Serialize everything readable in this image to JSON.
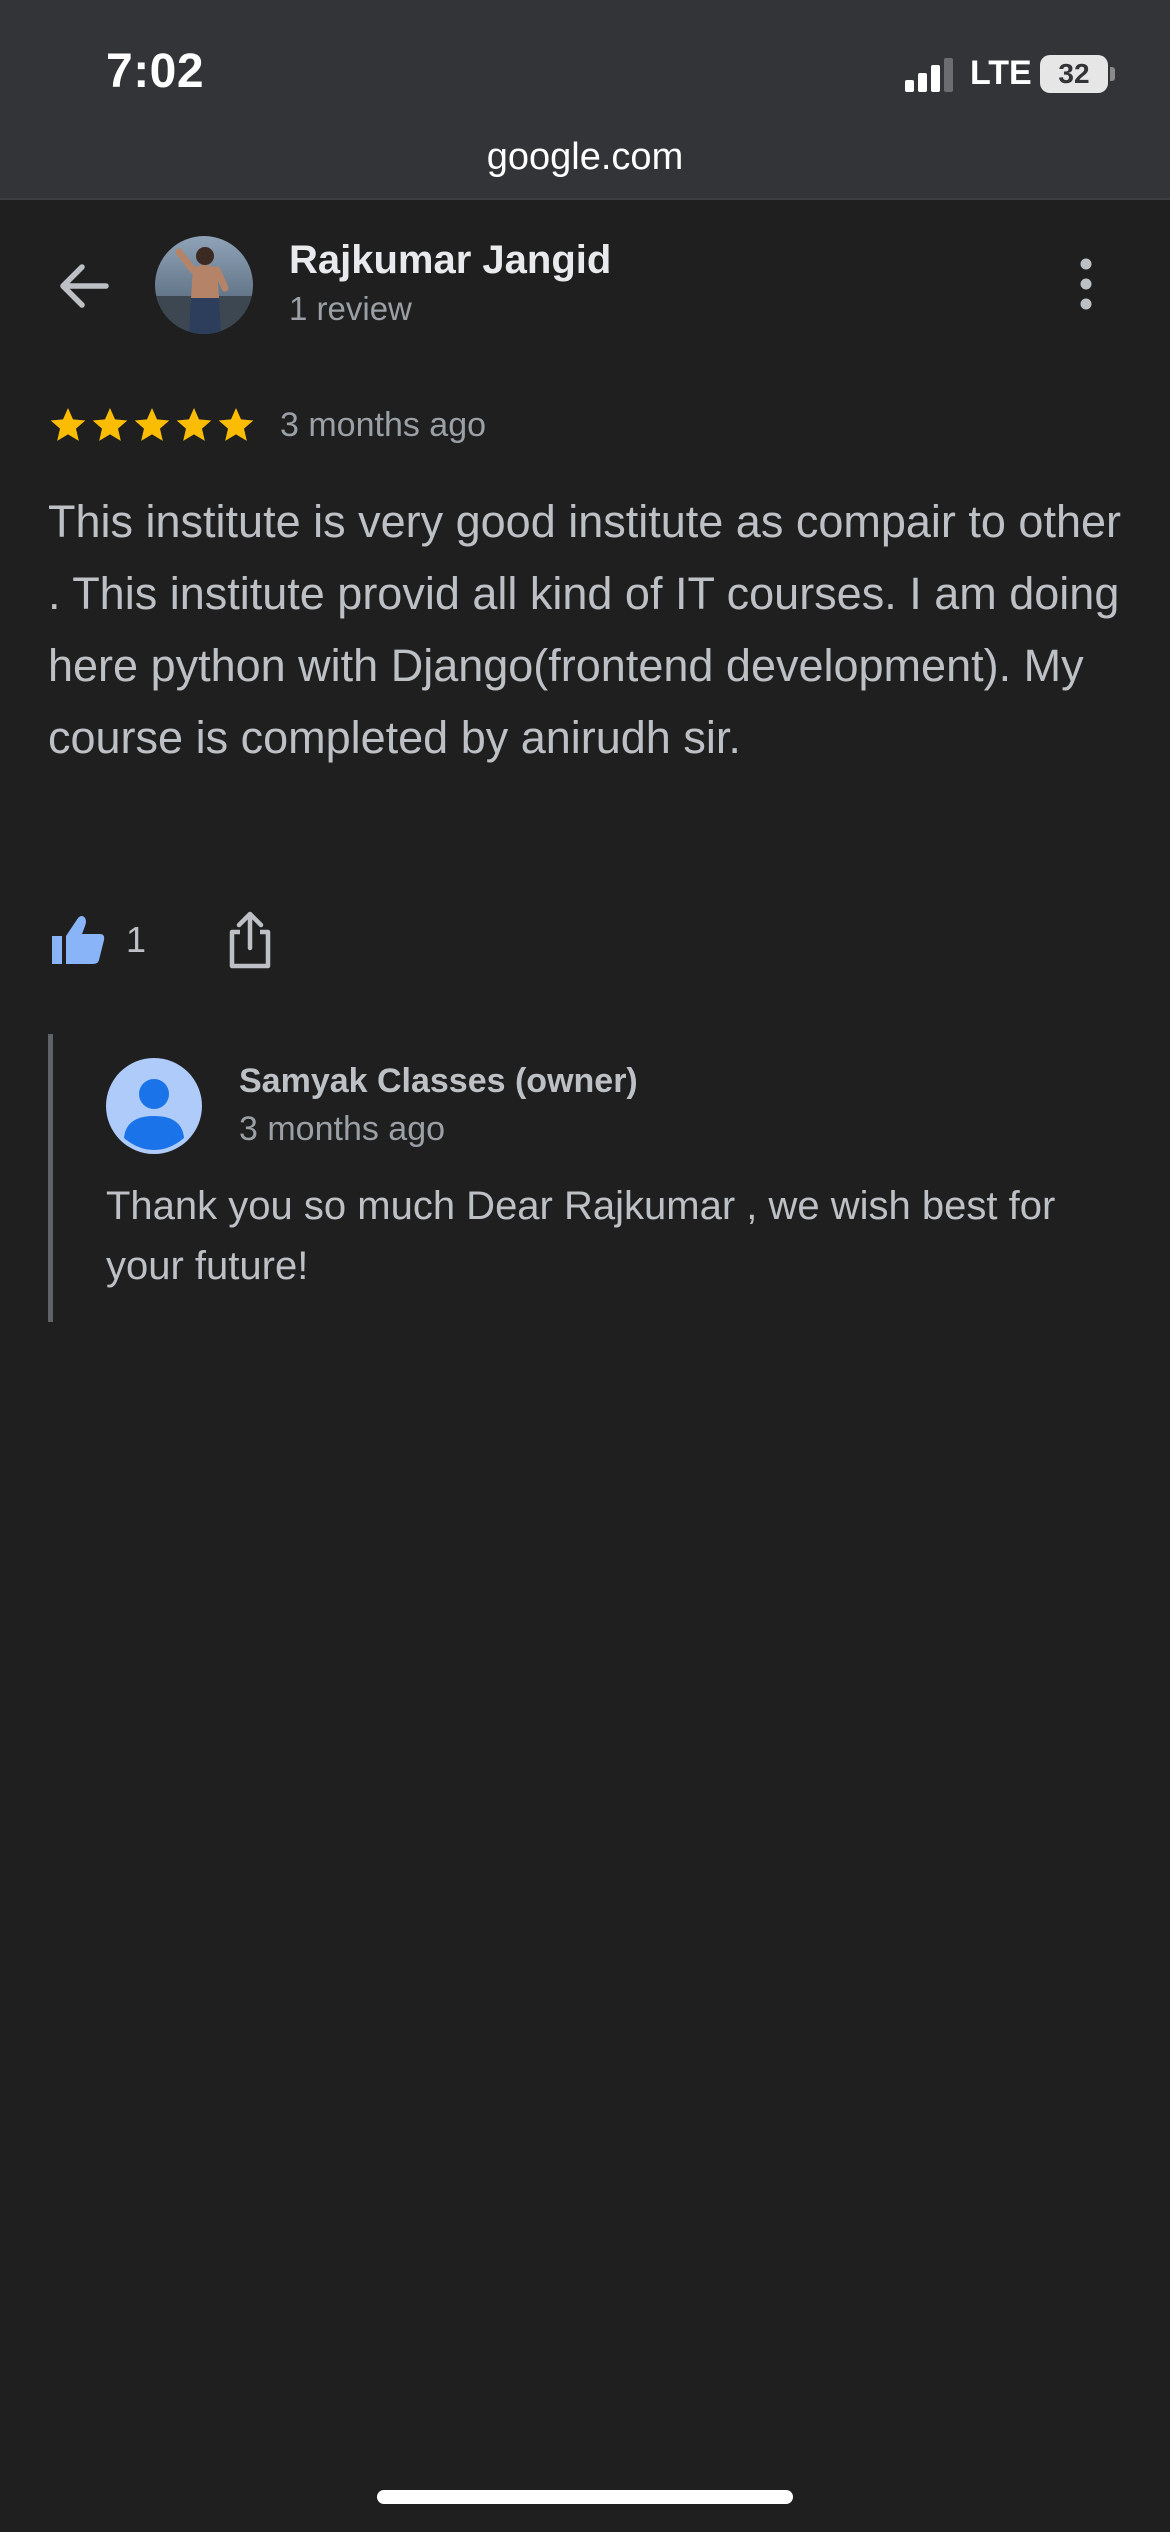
{
  "status_bar": {
    "time": "7:02",
    "network": "LTE",
    "battery_level": "32",
    "url": "google.com"
  },
  "header": {
    "reviewer_name": "Rajkumar Jangid",
    "review_count": "1 review",
    "back_icon": "arrow-back-icon",
    "more_icon": "more-vert-icon"
  },
  "review": {
    "stars": 5,
    "star_color": "#fbbc04",
    "date": "3 months ago",
    "text": "This institute is very good institute as compair to other . This institute provid all kind of IT courses. I am doing here python with Django(frontend development). My course is completed by anirudh sir.",
    "like_count": "1",
    "like_color": "#8ab4f8"
  },
  "reply": {
    "owner_name": "Samyak Classes (owner)",
    "date": "3 months ago",
    "text": "Thank you so much Dear Rajkumar , we wish best for your future!",
    "avatar_bg": "#aecbfa",
    "avatar_fg": "#1a73e8"
  }
}
